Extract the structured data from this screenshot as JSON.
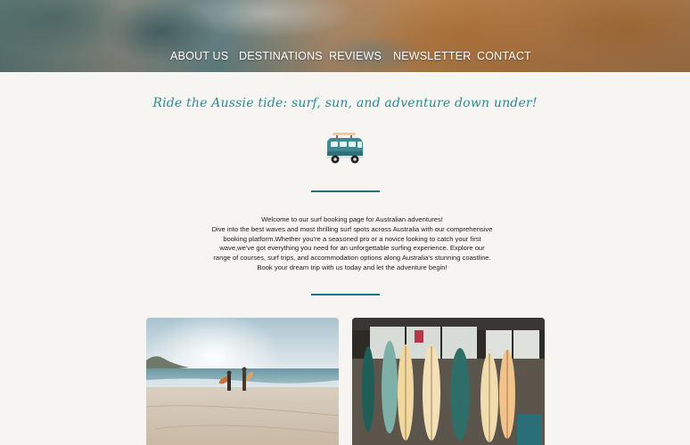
{
  "nav": {
    "items": [
      {
        "label": "ABOUT US"
      },
      {
        "label": "DESTINATIONS"
      },
      {
        "label": "REVIEWS"
      },
      {
        "label": "NEWSLETTER"
      },
      {
        "label": "CONTACT"
      }
    ]
  },
  "tagline": "Ride the Aussie tide: surf, sun, and adventure down under!",
  "intro": {
    "line1": "Welcome to our surf booking page for Australian adventures!",
    "line2": "Dive into the best waves and most thrilling surf spots across Australia with our comprehensive booking platform.Whether you're a seasoned pro or a novice looking to catch your first wave,we've got everything you need for an unforgettable surfing experience. Explore our range of courses, surf trips, and accommodation options along Australia's stunning coastline.",
    "line3": "Book your dream trip with us today and let the adventure begin!"
  },
  "icons": {
    "van": "camper-van-icon"
  },
  "colors": {
    "accent": "#2c8a93",
    "divider": "#1f6f86",
    "background": "#f6f5f1"
  }
}
